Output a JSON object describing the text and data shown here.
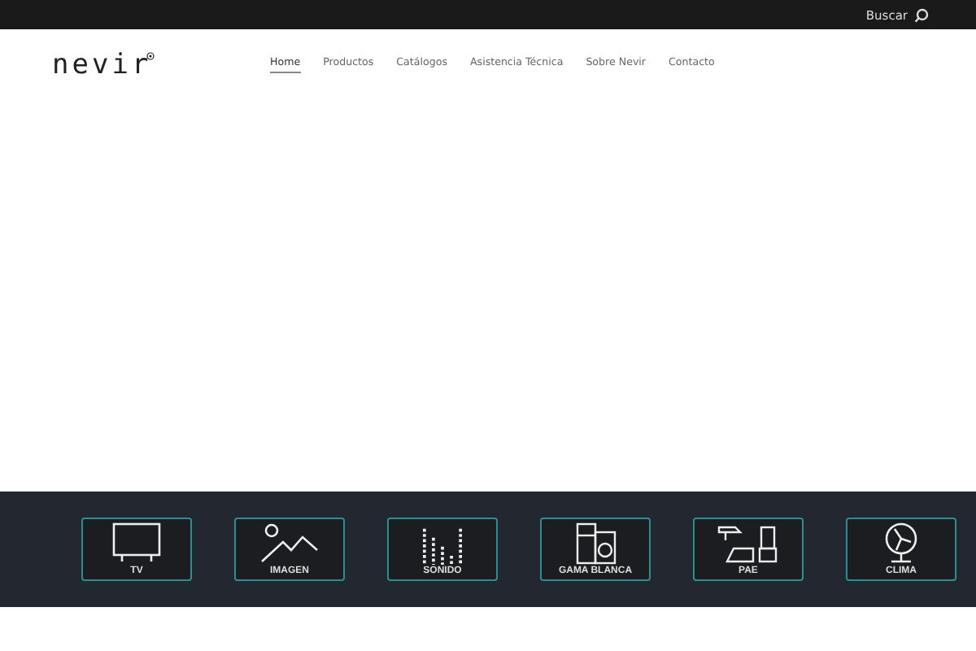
{
  "top_bar": {
    "search_label": "Buscar"
  },
  "header": {
    "logo": "nevir",
    "nav": [
      {
        "label": "Home",
        "selected": true
      },
      {
        "label": "Productos",
        "selected": false
      },
      {
        "label": "Catálogos",
        "selected": false
      },
      {
        "label": "Asistencia Técnica",
        "selected": false
      },
      {
        "label": "Sobre Nevir",
        "selected": false
      },
      {
        "label": "Contacto",
        "selected": false
      }
    ]
  },
  "categories": [
    {
      "kind": "tv",
      "label": "TV"
    },
    {
      "kind": "image",
      "label": "IMAGEN"
    },
    {
      "kind": "sound",
      "label": "SONIDO"
    },
    {
      "kind": "white",
      "label": "GAMA BLANCA"
    },
    {
      "kind": "pae",
      "label": "PAE"
    },
    {
      "kind": "clima",
      "label": "CLIMA"
    }
  ]
}
